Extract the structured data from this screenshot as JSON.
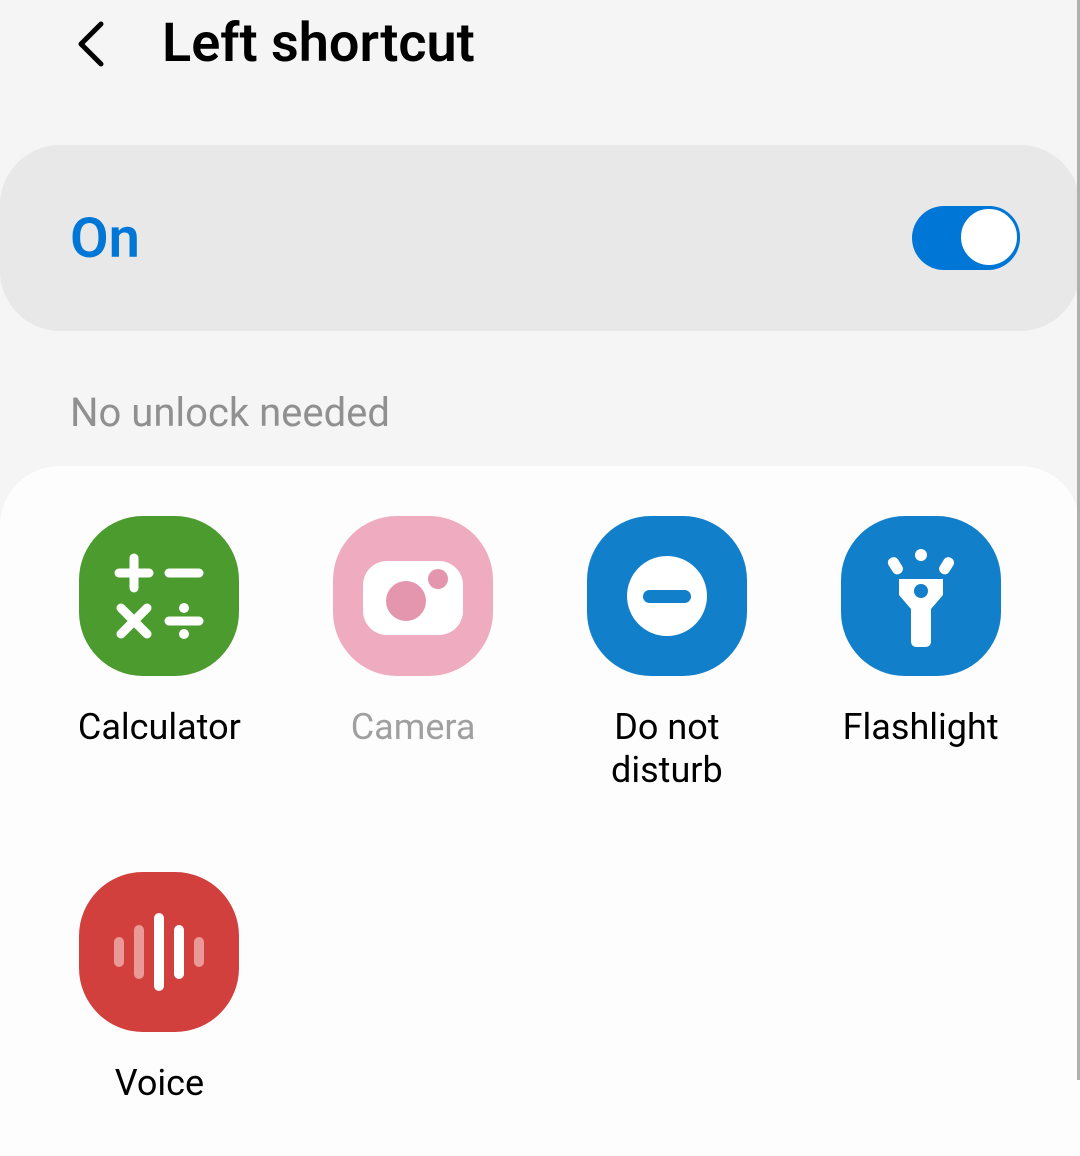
{
  "header": {
    "title": "Left shortcut"
  },
  "toggle": {
    "label": "On",
    "enabled": true
  },
  "section": {
    "label": "No unlock needed"
  },
  "apps": [
    {
      "name": "Calculator",
      "icon": "calculator",
      "bg": "#4b9b2e",
      "dim": false
    },
    {
      "name": "Camera",
      "icon": "camera",
      "bg": "#efabc0",
      "dim": true
    },
    {
      "name": "Do not disturb",
      "icon": "dnd",
      "bg": "#117fc9",
      "dim": false
    },
    {
      "name": "Flashlight",
      "icon": "flashlight",
      "bg": "#117fc9",
      "dim": false
    },
    {
      "name": "Voice",
      "icon": "voice",
      "bg": "#d1403d",
      "dim": false
    }
  ]
}
